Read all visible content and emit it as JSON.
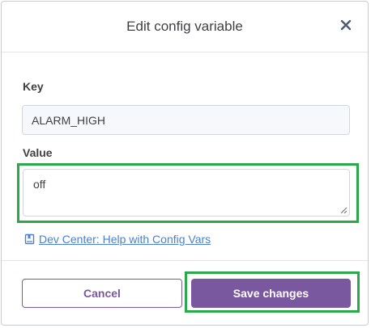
{
  "modal": {
    "title": "Edit config variable",
    "close_icon": "close-icon"
  },
  "form": {
    "key_label": "Key",
    "key_value": "ALARM_HIGH",
    "value_label": "Value",
    "value_value": "off",
    "resize_icon": "resize-handle-icon"
  },
  "help": {
    "icon": "bookmark-icon",
    "link_text": "Dev Center: Help with Config Vars"
  },
  "footer": {
    "cancel_label": "Cancel",
    "save_label": "Save changes"
  },
  "colors": {
    "accent": "#79589f",
    "link": "#4a7fd0",
    "highlight": "#2aa84a",
    "text": "#3f3f44"
  }
}
